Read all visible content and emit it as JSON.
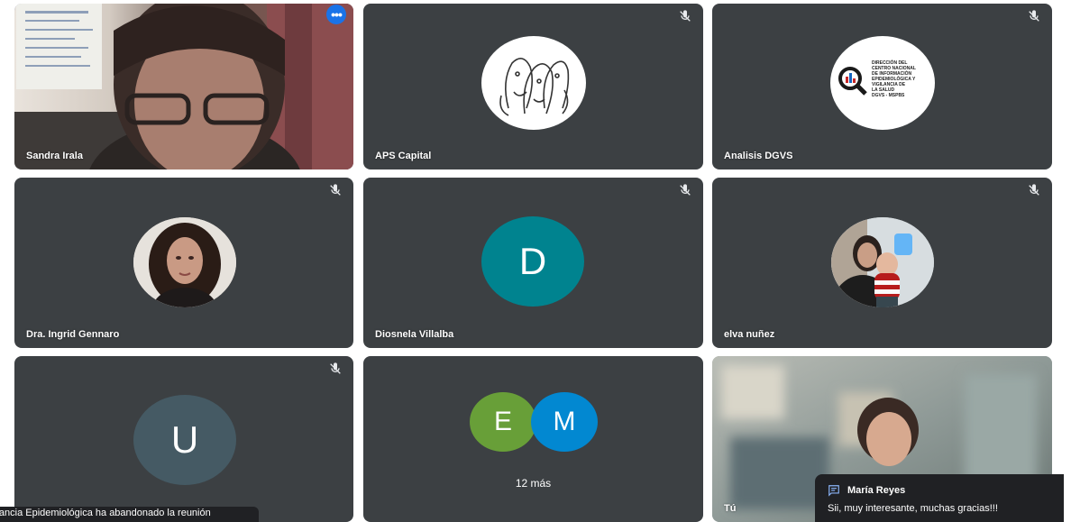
{
  "participants": [
    {
      "id": "sandra",
      "name": "Sandra Irala"
    },
    {
      "id": "aps",
      "name": "APS Capital"
    },
    {
      "id": "dgvs",
      "name": "Analisis DGVS"
    },
    {
      "id": "ingrid",
      "name": "Dra. Ingrid Gennaro"
    },
    {
      "id": "diosnela",
      "name": "Diosnela Villalba",
      "initial": "D"
    },
    {
      "id": "elva",
      "name": "elva nuñez"
    },
    {
      "id": "u",
      "initial": "U"
    },
    {
      "id": "you",
      "name": "Tú"
    }
  ],
  "overflow": {
    "initials": [
      "E",
      "M"
    ],
    "label": "12 más"
  },
  "dgvs_logo": {
    "lines": [
      "DIRECCIÓN DEL",
      "CENTRO NACIONAL",
      "DE INFORMACIÓN",
      "EPIDEMIOLÓGICA Y",
      "VIGILANCIA DE",
      "LA SALUD",
      "DGVS - MSPBS"
    ]
  },
  "notification": {
    "text": "ilancia Epidemiológica ha abandonado la reunión"
  },
  "chat": {
    "sender": "María Reyes",
    "message": "Sii, muy interesante, muchas gracias!!!"
  },
  "colors": {
    "tile": "#3c4043",
    "active_border": "#8ab4f8",
    "avatar_d": "#00838f",
    "avatar_u": "#455a64",
    "avatar_e": "#689f38",
    "avatar_m": "#0288d1"
  },
  "icons": {
    "muted": "mic-off-icon",
    "more": "more-options-icon",
    "chat": "chat-icon"
  }
}
